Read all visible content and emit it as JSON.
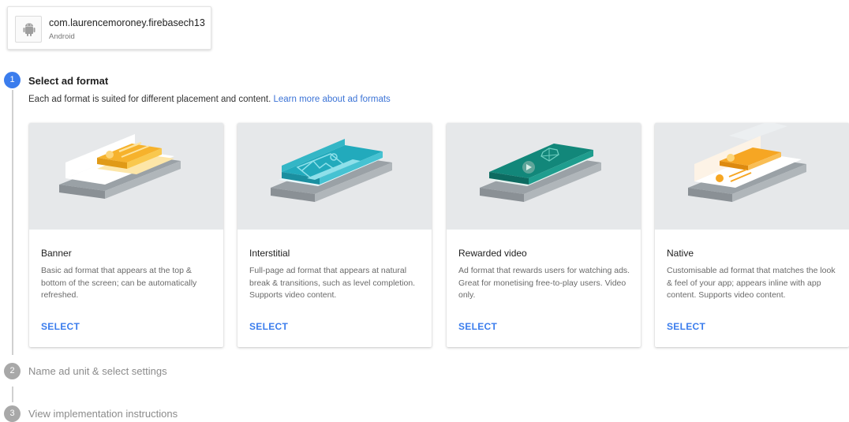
{
  "app": {
    "package": "com.laurencemoroney.firebasech13",
    "platform": "Android",
    "icon": "android-icon"
  },
  "steps": [
    {
      "number": "1",
      "title": "Select ad format",
      "state": "active"
    },
    {
      "number": "2",
      "title": "Name ad unit & select settings",
      "state": "inactive"
    },
    {
      "number": "3",
      "title": "View implementation instructions",
      "state": "inactive"
    }
  ],
  "step1": {
    "description": "Each ad format is suited for different placement and content.",
    "learn_more": "Learn more about ad formats"
  },
  "formats": [
    {
      "title": "Banner",
      "description": "Basic ad format that appears at the top & bottom of the screen; can be automatically refreshed.",
      "select": "SELECT",
      "accent": "#f6b22c"
    },
    {
      "title": "Interstitial",
      "description": "Full-page ad format that appears at natural break & transitions, such as level completion. Supports video content.",
      "select": "SELECT",
      "accent": "#22aabc"
    },
    {
      "title": "Rewarded video",
      "description": "Ad format that rewards users for watching ads. Great for monetising free-to-play users. Video only.",
      "select": "SELECT",
      "accent": "#12877a"
    },
    {
      "title": "Native",
      "description": "Customisable ad format that matches the look & feel of your app; appears inline with app content. Supports video content.",
      "select": "SELECT",
      "accent": "#f6a623"
    }
  ],
  "colors": {
    "primary": "#3b7ded",
    "inactive": "#a8a8a8",
    "art_bg": "#e6e8ea"
  }
}
